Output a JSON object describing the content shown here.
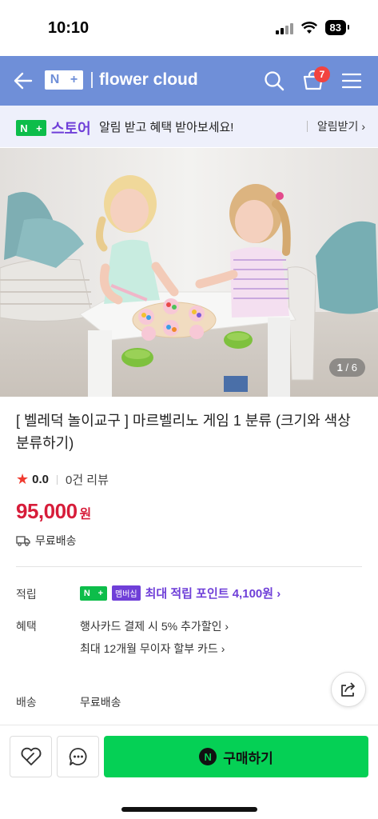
{
  "status_bar": {
    "time": "10:10",
    "battery": "83"
  },
  "header": {
    "logo_n": "N",
    "logo_plus": "+",
    "store_name": "flower cloud",
    "cart_count": "7"
  },
  "promo": {
    "logo_n": "N",
    "logo_plus": "+",
    "store_label": "스토어",
    "message": "알림 받고 혜택 받아보세요!",
    "action": "알림받기 ›"
  },
  "gallery": {
    "current": "1",
    "separator": "/",
    "total": "6"
  },
  "product": {
    "title": "[ 벨레덕 놀이교구 ] 마르벨리노 게임 1 분류 (크기와 색상 분류하기)",
    "rating": "0.0",
    "reviews": "0건 리뷰",
    "price": "95,000",
    "price_unit": "원",
    "shipping": "무료배송"
  },
  "details": {
    "points_label": "적립",
    "membership_n": "N",
    "membership_plus": "+",
    "membership_badge": "멤버십",
    "points_text": "최대 적립 포인트 4,100원 ›",
    "benefit_label": "혜택",
    "benefit_1": "행사카드 결제 시 5% 추가할인 ›",
    "benefit_2": "최대 12개월 무이자 할부 카드 ›",
    "delivery_label": "배송",
    "delivery_value": "무료배송"
  },
  "bottom": {
    "buy_icon": "N",
    "buy_label": "구매하기"
  },
  "colors": {
    "header": "#6f8fd8",
    "naver_green": "#05d055",
    "price_red": "#d71d3a",
    "purple": "#6f3fd8",
    "badge_red": "#f2433f"
  }
}
